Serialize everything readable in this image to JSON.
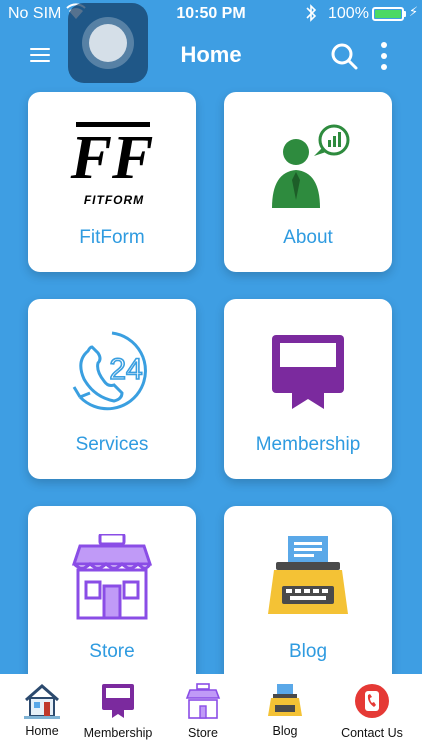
{
  "status_bar": {
    "carrier": "No SIM",
    "time": "10:50 PM",
    "battery": "100%",
    "battery_level": 1.0
  },
  "nav": {
    "title": "Home",
    "icons": [
      "menu-icon",
      "search-icon",
      "more-vertical-icon"
    ]
  },
  "tiles": [
    {
      "label": "FitForm",
      "logo_text": "FF",
      "logo_sub": "FITFORM",
      "icon": "fitform-logo"
    },
    {
      "label": "About",
      "icon": "businessman-chat-icon"
    },
    {
      "label": "Services",
      "icon": "support-24-icon"
    },
    {
      "label": "Membership",
      "icon": "membership-card-icon"
    },
    {
      "label": "Store",
      "icon": "storefront-icon"
    },
    {
      "label": "Blog",
      "icon": "typewriter-icon"
    }
  ],
  "tabbar": {
    "items": [
      {
        "label": "Home",
        "icon": "house-icon"
      },
      {
        "label": "Membership",
        "icon": "membership-card-icon"
      },
      {
        "label": "Store",
        "icon": "storefront-icon"
      },
      {
        "label": "Blog",
        "icon": "typewriter-icon"
      },
      {
        "label": "Contact Us",
        "icon": "phone-icon"
      }
    ]
  },
  "colors": {
    "background": "#3e9ee3",
    "accent_text": "#2f9be0",
    "membership_purple": "#7b2a9e",
    "about_green": "#2e8b3e",
    "contact_red": "#e53935",
    "battery_green": "#4cd964"
  }
}
